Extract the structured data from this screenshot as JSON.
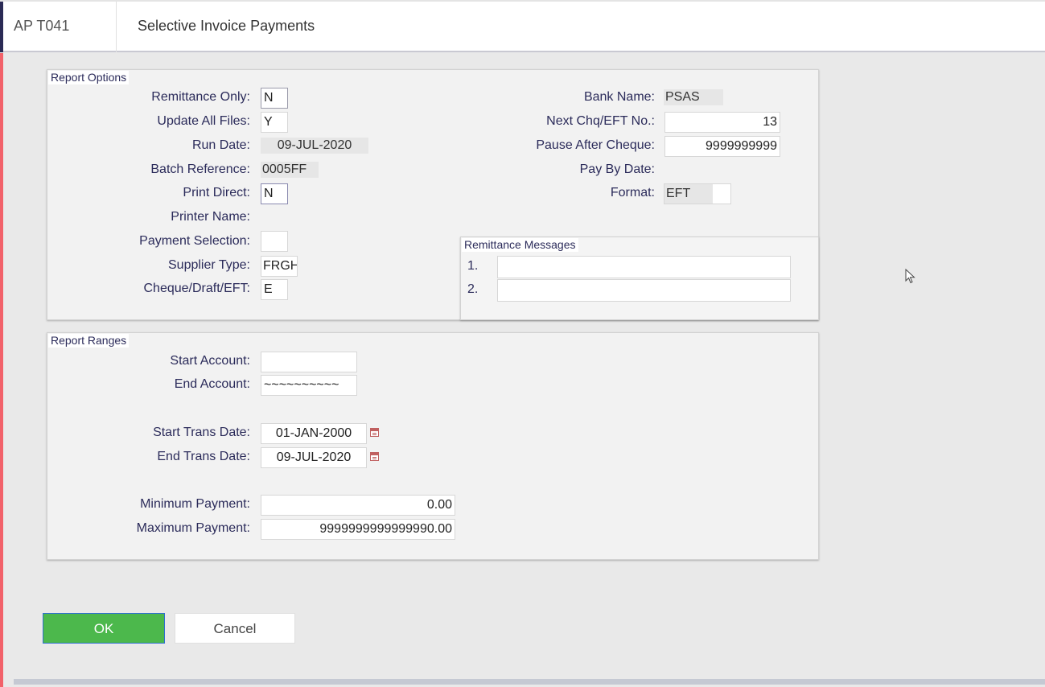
{
  "header": {
    "module_code": "AP T041",
    "title": "Selective Invoice Payments"
  },
  "report_options": {
    "legend": "Report Options",
    "remittance_only": {
      "label": "Remittance Only:",
      "value": "N"
    },
    "update_all_files": {
      "label": "Update All Files:",
      "value": "Y"
    },
    "run_date": {
      "label": "Run Date:",
      "value": "09-JUL-2020"
    },
    "batch_reference": {
      "label": "Batch Reference:",
      "value": "0005FF"
    },
    "print_direct": {
      "label": "Print Direct:",
      "value": "N"
    },
    "printer_name": {
      "label": "Printer Name:",
      "value": ""
    },
    "payment_selection": {
      "label": "Payment Selection:",
      "value": ""
    },
    "supplier_type": {
      "label": "Supplier Type:",
      "value": "FRGH"
    },
    "cheque_draft_eft": {
      "label": "Cheque/Draft/EFT:",
      "value": "E"
    },
    "bank_name": {
      "label": "Bank Name:",
      "value": "PSAS"
    },
    "next_chq_eft_no": {
      "label": "Next Chq/EFT No.:",
      "value": "13"
    },
    "pause_after_cheque": {
      "label": "Pause After Cheque:",
      "value": "9999999999"
    },
    "pay_by_date": {
      "label": "Pay By Date:",
      "value": ""
    },
    "format": {
      "label": "Format:",
      "value": "EFT"
    }
  },
  "remittance_messages": {
    "legend": "Remittance Messages",
    "lines": [
      {
        "number": "1.",
        "value": ""
      },
      {
        "number": "2.",
        "value": ""
      }
    ]
  },
  "report_ranges": {
    "legend": "Report Ranges",
    "start_account": {
      "label": "Start Account:",
      "value": ""
    },
    "end_account": {
      "label": "End Account:",
      "value": "~~~~~~~~~~"
    },
    "start_trans_date": {
      "label": "Start Trans Date:",
      "value": "01-JAN-2000"
    },
    "end_trans_date": {
      "label": "End Trans Date:",
      "value": "09-JUL-2020"
    },
    "minimum_payment": {
      "label": "Minimum Payment:",
      "value": "0.00"
    },
    "maximum_payment": {
      "label": "Maximum Payment:",
      "value": "9999999999999990.00"
    }
  },
  "buttons": {
    "ok": "OK",
    "cancel": "Cancel"
  },
  "colors": {
    "ok_button": "#4cb84c",
    "accent_left": "#f2626a",
    "label_text": "#2b2b5a"
  }
}
